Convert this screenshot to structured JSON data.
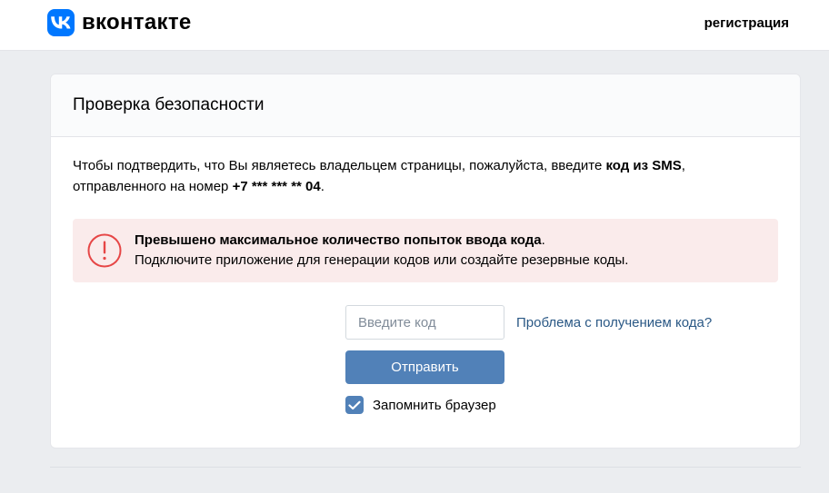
{
  "header": {
    "logo_text": "вконтакте",
    "register_link": "регистрация"
  },
  "card": {
    "title": "Проверка безопасности",
    "description": {
      "part1": "Чтобы подтвердить, что Вы являетесь владельцем страницы, пожалуйста, введите ",
      "bold1": "код из SMS",
      "part2": ",",
      "part3": "отправленного на номер ",
      "phone": "+7 *** *** ** 04",
      "part4": "."
    },
    "alert": {
      "title": "Превышено максимальное количество попыток ввода кода",
      "title_suffix": ".",
      "message": "Подключите приложение для генерации кодов или создайте резервные коды."
    },
    "form": {
      "code_placeholder": "Введите код",
      "code_value": "",
      "problem_link": "Проблема с получением кода?",
      "submit_label": "Отправить",
      "remember_label": "Запомнить браузер",
      "remember_checked": true
    }
  },
  "colors": {
    "brand": "#0077ff",
    "button": "#5181b8",
    "link": "#2a5885",
    "alert_bg": "#faebeb",
    "alert_icon": "#e64646"
  }
}
